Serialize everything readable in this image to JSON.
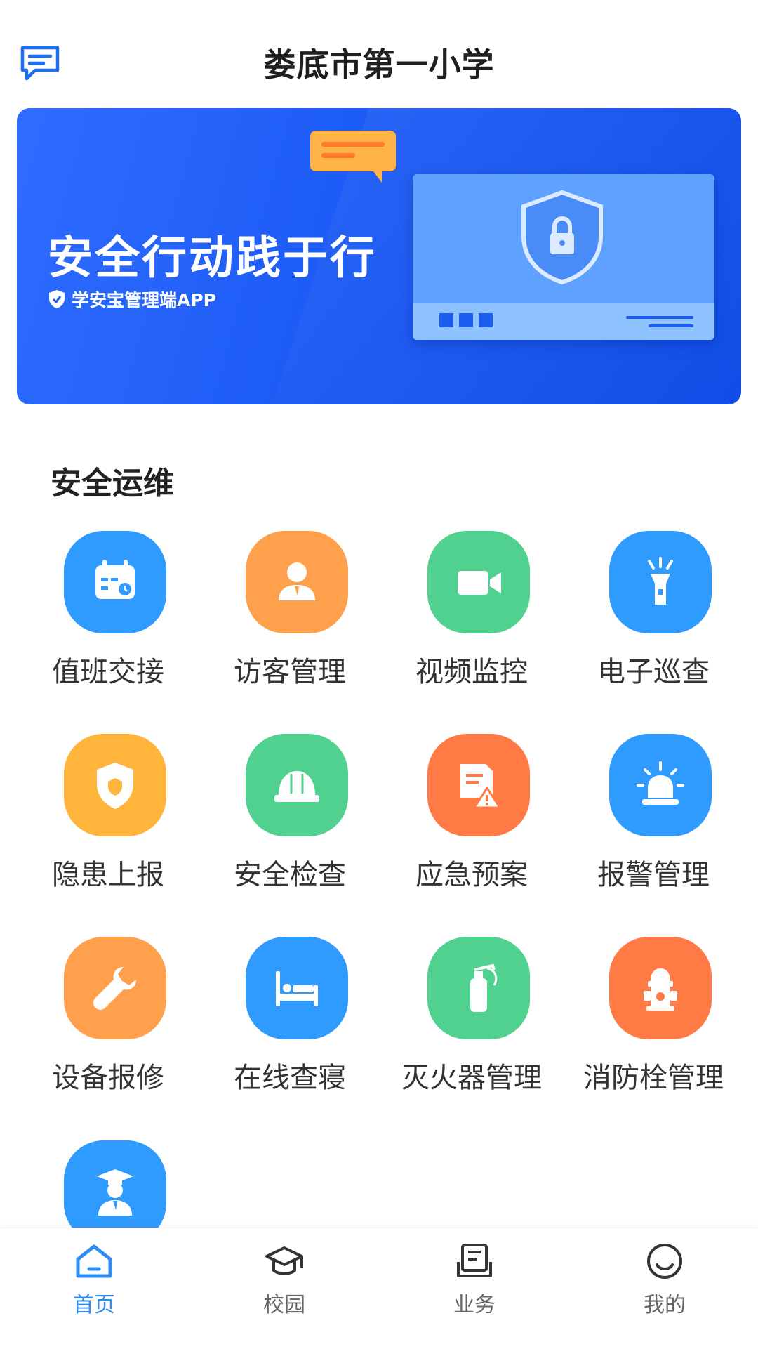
{
  "header": {
    "title": "娄底市第一小学",
    "message_icon": "message-icon"
  },
  "banner": {
    "headline": "安全行动践于行",
    "subtitle": "学安宝管理端APP",
    "colors": {
      "bg": "#1c5bf5"
    }
  },
  "section": {
    "title": "安全运维"
  },
  "grid": [
    {
      "label": "值班交接",
      "icon": "duty-calendar-icon",
      "color": "#2f9bff"
    },
    {
      "label": "访客管理",
      "icon": "visitor-icon",
      "color": "#ffa04d"
    },
    {
      "label": "视频监控",
      "icon": "video-camera-icon",
      "color": "#50d18f"
    },
    {
      "label": "电子巡查",
      "icon": "flashlight-icon",
      "color": "#2f9bff"
    },
    {
      "label": "隐患上报",
      "icon": "shield-icon",
      "color": "#ffb53c"
    },
    {
      "label": "安全检查",
      "icon": "helmet-icon",
      "color": "#50d18f"
    },
    {
      "label": "应急预案",
      "icon": "document-warning-icon",
      "color": "#ff7a45"
    },
    {
      "label": "报警管理",
      "icon": "alarm-siren-icon",
      "color": "#2f9bff"
    },
    {
      "label": "设备报修",
      "icon": "wrench-icon",
      "color": "#ffa04d"
    },
    {
      "label": "在线查寝",
      "icon": "bed-icon",
      "color": "#2f9bff"
    },
    {
      "label": "灭火器管理",
      "icon": "fire-extinguisher-icon",
      "color": "#50d18f"
    },
    {
      "label": "消防栓管理",
      "icon": "fire-hydrant-icon",
      "color": "#ff7a45"
    },
    {
      "label": "",
      "icon": "graduate-icon",
      "color": "#2f9bff"
    }
  ],
  "tabbar": {
    "items": [
      {
        "label": "首页",
        "icon": "home-icon",
        "active": true
      },
      {
        "label": "校园",
        "icon": "graduation-cap-icon",
        "active": false
      },
      {
        "label": "业务",
        "icon": "book-icon",
        "active": false
      },
      {
        "label": "我的",
        "icon": "smile-icon",
        "active": false
      }
    ],
    "active_color": "#2f8cf3"
  }
}
